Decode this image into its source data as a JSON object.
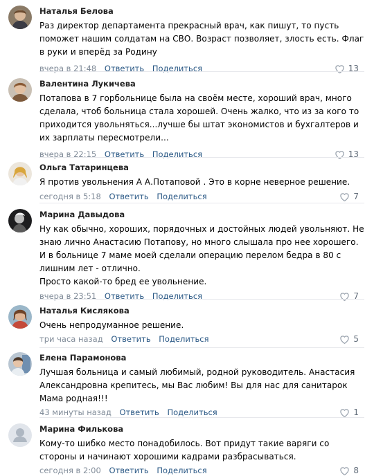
{
  "comments": [
    {
      "author": "Наталья Белова",
      "lines": [
        "Раз директор департамента прекрасный врач, как пишут, то пусть поможет нашим солдатам на СВО. Возраст позволяет, злость есть. Флаг в руки и вперёд за Родину"
      ],
      "time": "вчера в 21:48",
      "reply": "Ответить",
      "share": "Поделиться",
      "likes": "13",
      "avatar_icon": "user-photo"
    },
    {
      "author": "Валентина Лукичева",
      "lines": [
        "Потапова в 7 горбольнице была на своём месте, хороший врач, много сделала, чтоб больница стала хорошей. Очень жалко, что из за кого то приходится увольняться...лучше бы штат экономистов и бухгалтеров и их зарплаты пересмотрели..."
      ],
      "time": "вчера в 22:15",
      "reply": "Ответить",
      "share": "Поделиться",
      "likes": "13",
      "avatar_icon": "user-photo"
    },
    {
      "author": "Ольга Татаринцева",
      "lines": [
        "Я против увольнения А А.Потаповой . Это в корне неверное решение."
      ],
      "time": "сегодня в 5:18",
      "reply": "Ответить",
      "share": "Поделиться",
      "likes": "7",
      "avatar_icon": "user-photo"
    },
    {
      "author": "Марина Давыдова",
      "lines": [
        "Ну как обычно, хороших, порядочных и достойных людей увольняют. Не знаю лично Анастасию Потапову, но много слышала про нее хорошего. И в больнице 7 маме моей сделали операцию перелом бедра в 80 с лишним лет - отлично.",
        "Просто какой-то бред ее увольнение."
      ],
      "time": "вчера в 23:51",
      "reply": "Ответить",
      "share": "Поделиться",
      "likes": "7",
      "avatar_icon": "user-photo"
    },
    {
      "author": "Наталья Кислякова",
      "lines": [
        "Очень непродуманное решение."
      ],
      "time": "три часа назад",
      "reply": "Ответить",
      "share": "Поделиться",
      "likes": "5",
      "avatar_icon": "user-photo"
    },
    {
      "author": "Елена Парамонова",
      "lines": [
        "Лучшая больница и самый любимый, родной руководитель. Анастасия Александровна крепитесь, мы Вас любим! Вы для нас для санитарок Мама родная!!!"
      ],
      "time": "43 минуты назад",
      "reply": "Ответить",
      "share": "Поделиться",
      "likes": "1",
      "avatar_icon": "user-photo"
    },
    {
      "author": "Марина Филькова",
      "lines": [
        "Кому-то шибко место понадобилось. Вот придут такие варяги со стороны и начинают хорошими кадрами разбрасываться."
      ],
      "time": "сегодня в 2:00",
      "reply": "Ответить",
      "share": "Поделиться",
      "likes": "8",
      "avatar_icon": "default-avatar"
    }
  ]
}
